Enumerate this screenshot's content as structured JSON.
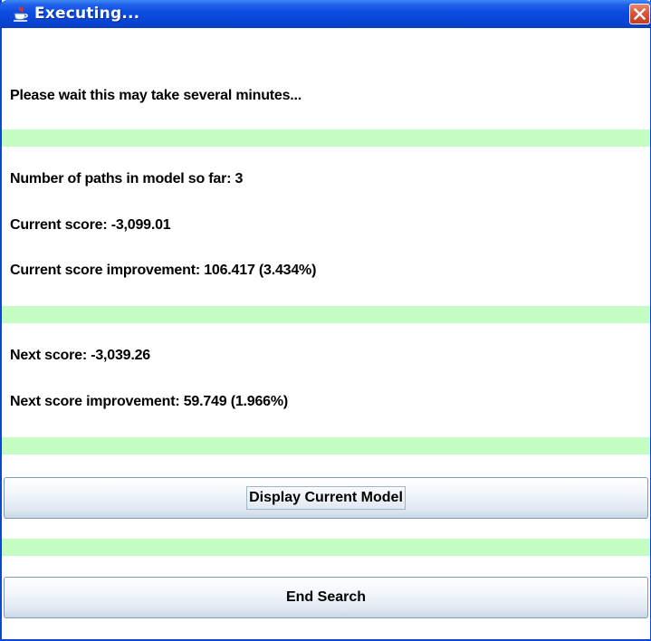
{
  "window": {
    "title": "Executing..."
  },
  "content": {
    "wait_message": "Please wait this may take several minutes...",
    "paths_so_far": "Number of paths in model so far: 3",
    "current_score": "Current score: -3,099.01",
    "current_improvement": "Current score improvement: 106.417 (3.434%)",
    "next_score": "Next score: -3,039.26",
    "next_improvement": "Next score improvement: 59.749 (1.966%)"
  },
  "buttons": {
    "display_current_model": "Display Current Model",
    "end_search": "End Search"
  },
  "colors": {
    "titlebar": "#0a4ce0",
    "separator": "#c4fdc4",
    "close_button": "#d9553a"
  },
  "icons": {
    "app": "java-coffee-cup-icon",
    "close": "close-icon"
  }
}
